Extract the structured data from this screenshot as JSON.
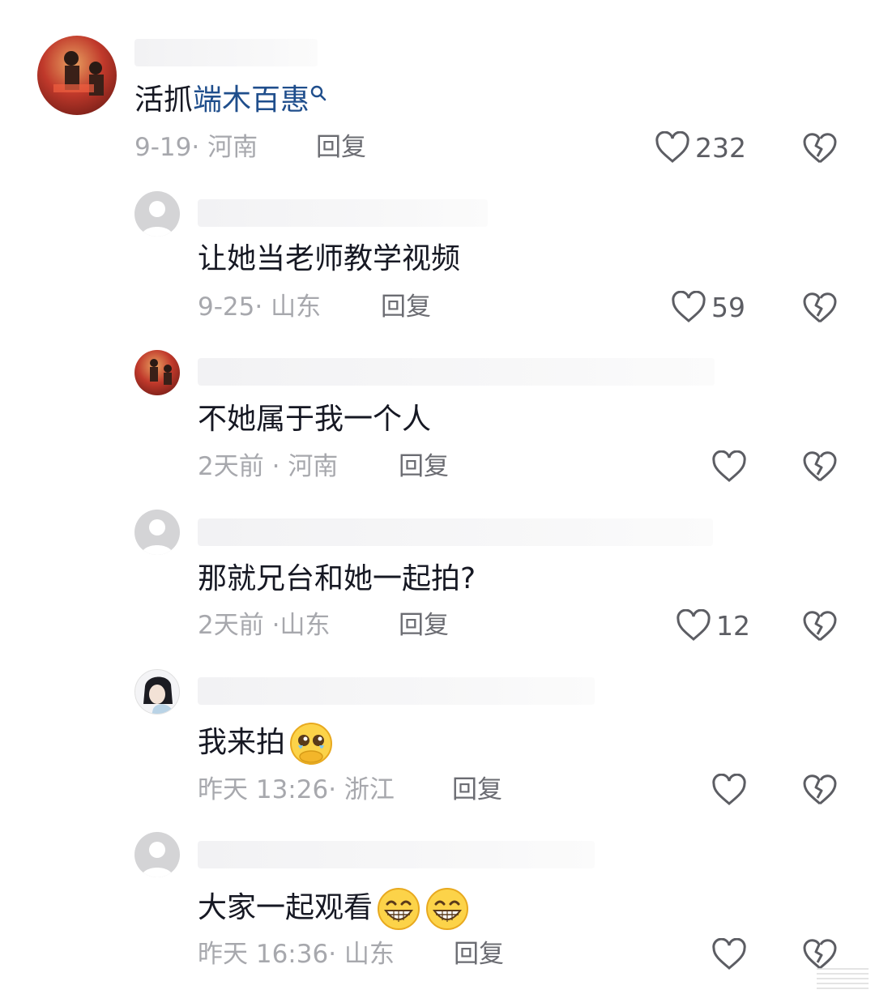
{
  "comments": [
    {
      "text_plain": "活抓",
      "text_link": "端木百惠",
      "date": "9-19",
      "location": "河南",
      "reply_label": "回复",
      "like_count": "232",
      "avatar_icon": "user-avatar-photo"
    },
    {
      "text": "让她当老师教学视频",
      "date": "9-25",
      "location": "山东",
      "reply_label": "回复",
      "like_count": "59",
      "avatar_icon": "default-avatar-icon"
    },
    {
      "text": "不她属于我一个人",
      "date": "2天前",
      "location": "河南",
      "reply_label": "回复",
      "like_count": "",
      "avatar_icon": "user-avatar-photo"
    },
    {
      "text": "那就兄台和她一起拍?",
      "date": "2天前",
      "location": "山东",
      "reply_label": "回复",
      "like_count": "12",
      "avatar_icon": "default-avatar-icon"
    },
    {
      "text": "我来拍",
      "date": "昨天 13:26",
      "location": "浙江",
      "reply_label": "回复",
      "like_count": "",
      "avatar_icon": "anime-avatar-icon",
      "emoji": [
        "pleading-emoji"
      ]
    },
    {
      "text": "大家一起观看",
      "date": "昨天 16:36",
      "location": "山东",
      "reply_label": "回复",
      "like_count": "",
      "avatar_icon": "default-avatar-icon",
      "emoji": [
        "grin-emoji",
        "grin-emoji"
      ]
    }
  ],
  "separator": "·",
  "colors": {
    "text": "#161823",
    "meta": "#a7a8ad",
    "reply": "#6b6c72",
    "link": "#1f4e8c",
    "icon": "#5c5d63"
  }
}
